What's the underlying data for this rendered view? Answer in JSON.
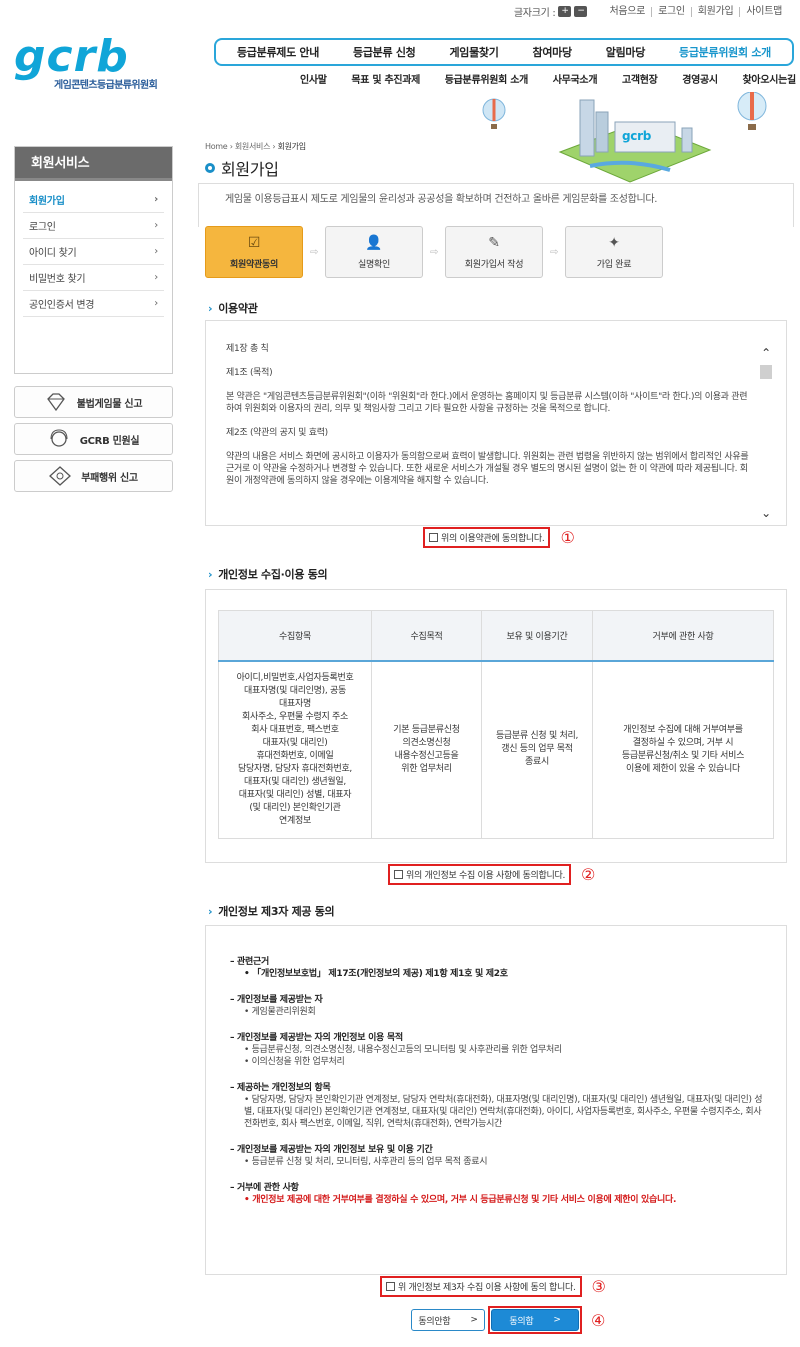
{
  "util": {
    "font_size_label": "글자크기 :",
    "plus": "+",
    "minus": "−",
    "links": [
      "처음으로",
      "로그인",
      "회원가입",
      "사이트맵"
    ]
  },
  "logo": {
    "mark": "gcrb",
    "subtitle": "게임콘텐츠등급분류위원회"
  },
  "gnb": {
    "items": [
      "등급분류제도 안내",
      "등급분류 신청",
      "게임물찾기",
      "참여마당",
      "알림마당",
      "등급분류위원회 소개"
    ],
    "active": "등급분류위원회 소개"
  },
  "sub_gnb": {
    "items": [
      "인사말",
      "목표 및 추진과제",
      "등급분류위원회 소개",
      "사무국소개",
      "고객현장",
      "경영공시",
      "찾아오시는길"
    ]
  },
  "lnb": {
    "title": "회원서비스",
    "items": [
      "회원가입",
      "로그인",
      "아이디 찾기",
      "비밀번호 찾기",
      "공인인증서 변경"
    ],
    "active": "회원가입"
  },
  "quick": [
    {
      "icon": "diamond-icon",
      "label": "불법게임물 신고"
    },
    {
      "icon": "headset-icon",
      "label": "GCRB 민원실"
    },
    {
      "icon": "chat-icon",
      "label": "부패행위 신고"
    }
  ],
  "breadcrumb": {
    "home": "Home",
    "sep": "›",
    "path": [
      "회원서비스",
      "회원가입"
    ]
  },
  "page_title": "회원가입",
  "intro": "게임물 이용등급표시 제도로 게임물의 윤리성과 공공성을 확보하며 건전하고 올바른 게임문화를 조성합니다.",
  "steps": [
    {
      "label": "회원약관동의",
      "icon": "check-icon",
      "active": true
    },
    {
      "label": "실명확인",
      "icon": "user-icon",
      "active": false
    },
    {
      "label": "회원가입서 작성",
      "icon": "write-icon",
      "active": false
    },
    {
      "label": "가입 완료",
      "icon": "complete-icon",
      "active": false
    }
  ],
  "terms": {
    "heading": "이용약관",
    "paragraphs": [
      "제1장 총 칙",
      "제1조 (목적)",
      "본 약관은 \"게임콘텐츠등급분류위원회\"(이하 \"위원회\"라 한다.)에서 운영하는 홈페이지 및 등급분류 시스템(이하 \"사이트\"라 한다.)의 이용과 관련하여 위원회와 이용자의 권리, 의무 및 책임사항 그리고 기타 필요한 사항을 규정하는 것을 목적으로 합니다.",
      "제2조 (약관의 공지 및 효력)",
      "약관의 내용은 서비스 화면에 공시하고 이용자가 동의함으로써 효력이 발생합니다. 위원회는 관련 법령을 위반하지 않는 범위에서 합리적인 사유를 근거로 이 약관을 수정하거나 변경할 수 있습니다. 또한 새로운 서비스가 개설될 경우 별도의 명시된 설명이 없는 한 이 약관에 따라 제공됩니다. 회원이 개정약관에 동의하지 않을 경우에는 이용계약을 해지할 수 있습니다."
    ],
    "agree": "위의 이용약관에 동의합니다.",
    "marker": "①"
  },
  "privacy": {
    "heading": "개인정보 수집·이용 동의",
    "headers": [
      "수집항목",
      "수집목적",
      "보유 및 이용기간",
      "거부에 관한 사항"
    ],
    "cells": [
      "아이디,비밀번호,사업자등록번호\n대표자명(및 대리인명), 공동\n대표자명\n회사주소, 우편물 수령지 주소\n회사 대표번호, 팩스번호\n대표자(및 대리인)\n휴대전화번호, 이메일\n담당자명, 담당자 휴대전화번호,\n대표자(및 대리인) 생년월일,\n대표자(및 대리인) 성별, 대표자\n(및 대리인) 본인확인기관\n연계정보",
      "기본 등급분류신청\n의견소명신청\n내용수정신고등을\n위한 업무처리",
      "등급분류 신청 및 처리,\n갱신 등의 업무 목적\n종료시",
      "개인정보 수집에 대해 거부여부를\n결정하실 수 있으며, 거부 시\n등급분류신청/취소 및 기타 서비스\n이용에 제한이 있을 수 있습니다"
    ],
    "agree": "위의 개인정보 수집 이용 사항에 동의합니다.",
    "marker": "②"
  },
  "third": {
    "heading": "개인정보 제3자 제공 동의",
    "sections": [
      {
        "title": "– 관련근거",
        "items": [
          "「개인정보보호법」 제17조(개인정보의 제공) 제1항 제1호 및 제2호"
        ],
        "style": "bold"
      },
      {
        "title": "– 개인정보를 제공받는 자",
        "items": [
          "게임물관리위원회"
        ],
        "style": "normal"
      },
      {
        "title": "– 개인정보를 제공받는 자의 개인정보 이용 목적",
        "items": [
          "등급분류신청, 의견소명신청, 내용수정신고등의 모니터링 및 사후관리를 위한 업무처리",
          "이의신청을 위한 업무처리"
        ],
        "style": "normal"
      },
      {
        "title": "– 제공하는 개인정보의 항목",
        "items": [
          "담당자명, 담당자 본인확인기관 연계정보, 담당자 연락처(휴대전화), 대표자명(및 대리인명), 대표자(및 대리인) 생년월일, 대표자(및 대리인) 성별, 대표자(및 대리인) 본인확인기관 연계정보, 대표자(및 대리인) 연락처(휴대전화), 아이디, 사업자등록번호, 회사주소, 우편물 수령지주소, 회사 전화번호, 회사 팩스번호, 이메일, 직위, 연락처(휴대전화), 연락가능시간"
        ],
        "style": "normal"
      },
      {
        "title": "– 개인정보를 제공받는 자의 개인정보 보유 및 이용 기간",
        "items": [
          "등급분류 신청 및 처리, 모니터링, 사후관리 등의 업무 목적 종료시"
        ],
        "style": "normal"
      },
      {
        "title": "– 거부에 관한 사항",
        "items": [
          "개인정보 제공에 대한 거부여부를 결정하실 수 있으며, 거부 시 등급분류신청 및 기타 서비스 이용에 제한이 있습니다."
        ],
        "style": "red"
      }
    ],
    "agree": "위 개인정보 제3자 수집 이용 사항에 동의 합니다.",
    "marker": "③"
  },
  "buttons": {
    "decline": "동의안함",
    "accept": "동의함",
    "arrow": ">",
    "marker": "④"
  }
}
